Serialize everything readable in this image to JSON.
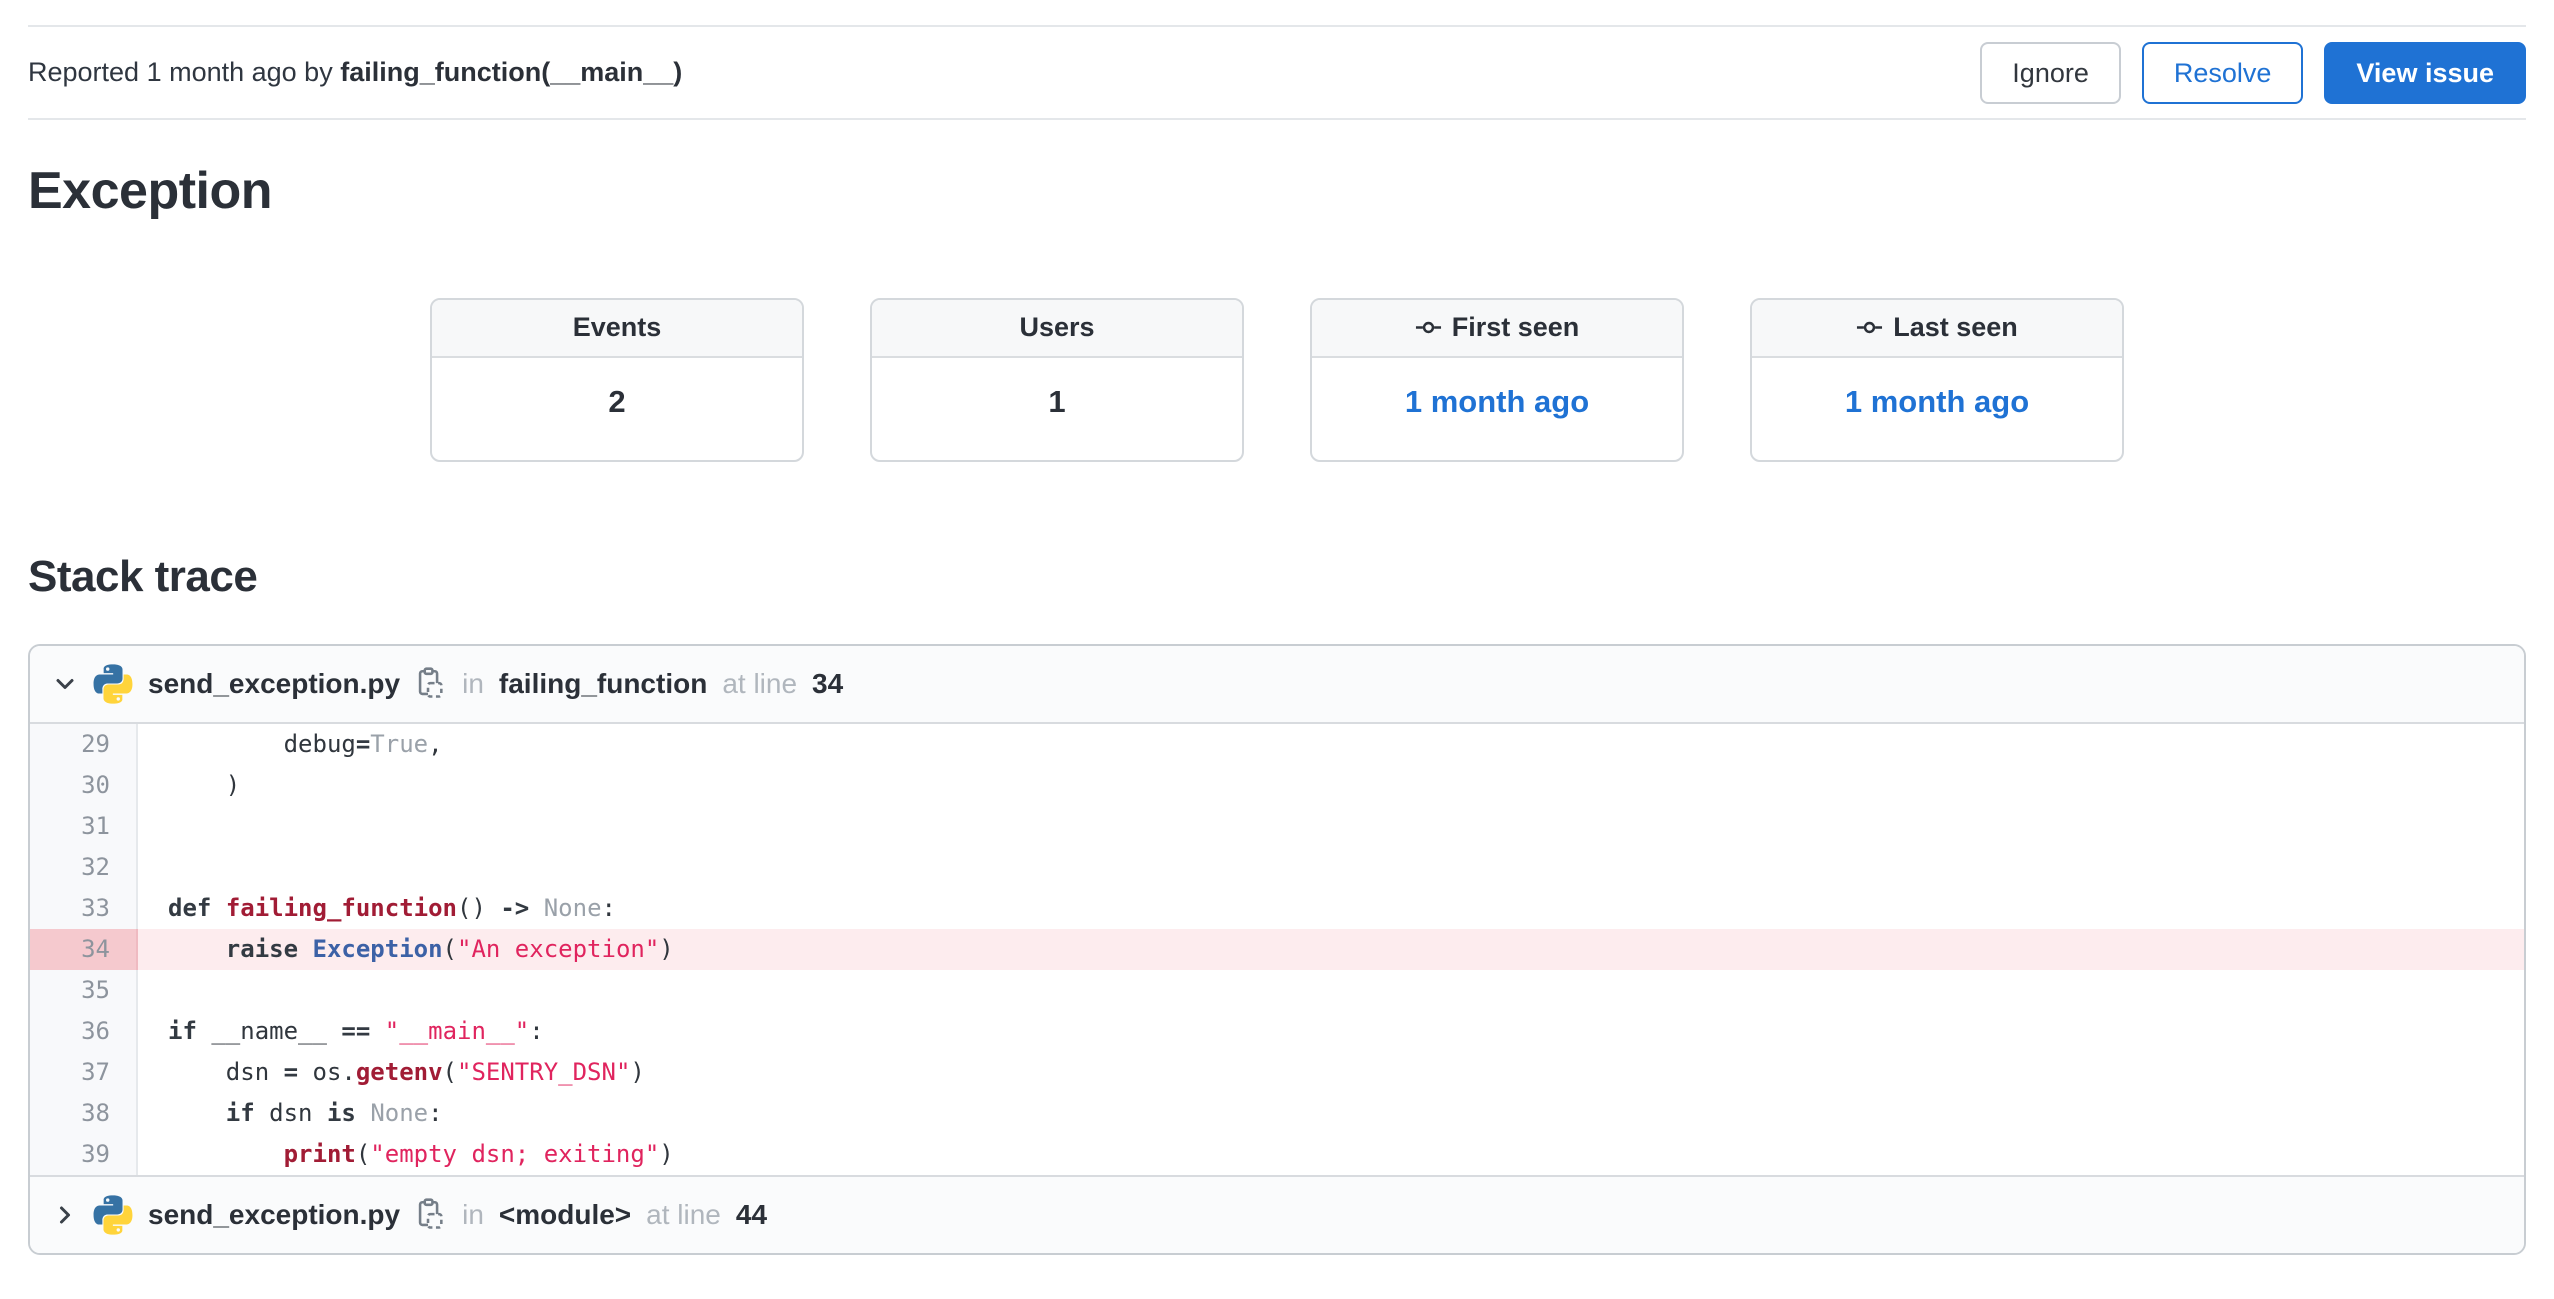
{
  "topbar": {
    "reported_prefix": "Reported 1 month ago by",
    "reporter": "failing_function(__main__)",
    "buttons": [
      {
        "label": "Ignore"
      },
      {
        "label": "Resolve"
      },
      {
        "label": "View issue"
      }
    ]
  },
  "exception": {
    "title": "Exception"
  },
  "stats": {
    "cards": [
      {
        "label": "Events",
        "value": "2"
      },
      {
        "label": "Users",
        "value": "1"
      },
      {
        "label": "First seen",
        "value": "1 month ago",
        "icon": "commit-icon",
        "value_is_link": true
      },
      {
        "label": "Last seen",
        "value": "1 month ago",
        "icon": "commit-icon",
        "value_is_link": true
      }
    ]
  },
  "stack_trace": {
    "title": "Stack trace",
    "frames": [
      {
        "file": "send_exception.py",
        "expanded": true,
        "in_label": "in",
        "function": "failing_function",
        "at_label": "at line",
        "line_number": "34",
        "language": "python",
        "code_lines": [
          {
            "no": "29",
            "highlight": false,
            "tokens": [
              [
                "p",
                "        debug"
              ],
              [
                "k",
                "="
              ],
              [
                "mut",
                "True"
              ],
              [
                "p",
                ","
              ]
            ]
          },
          {
            "no": "30",
            "highlight": false,
            "tokens": [
              [
                "p",
                "    )"
              ]
            ]
          },
          {
            "no": "31",
            "highlight": false,
            "tokens": []
          },
          {
            "no": "32",
            "highlight": false,
            "tokens": []
          },
          {
            "no": "33",
            "highlight": false,
            "tokens": [
              [
                "k",
                "def"
              ],
              [
                "p",
                " "
              ],
              [
                "fn",
                "failing_function"
              ],
              [
                "p",
                "() "
              ],
              [
                "k",
                "->"
              ],
              [
                "p",
                " "
              ],
              [
                "mut",
                "None"
              ],
              [
                "p",
                ":"
              ]
            ]
          },
          {
            "no": "34",
            "highlight": true,
            "tokens": [
              [
                "p",
                "    "
              ],
              [
                "k",
                "raise"
              ],
              [
                "p",
                " "
              ],
              [
                "cls",
                "Exception"
              ],
              [
                "p",
                "("
              ],
              [
                "str",
                "\"An exception\""
              ],
              [
                "p",
                ")"
              ]
            ]
          },
          {
            "no": "35",
            "highlight": false,
            "tokens": []
          },
          {
            "no": "36",
            "highlight": false,
            "tokens": [
              [
                "k",
                "if"
              ],
              [
                "p",
                " __name__ "
              ],
              [
                "k",
                "=="
              ],
              [
                "p",
                " "
              ],
              [
                "str",
                "\"__main__\""
              ],
              [
                "p",
                ":"
              ]
            ]
          },
          {
            "no": "37",
            "highlight": false,
            "tokens": [
              [
                "p",
                "    dsn "
              ],
              [
                "k",
                "="
              ],
              [
                "p",
                " os."
              ],
              [
                "fn",
                "getenv"
              ],
              [
                "p",
                "("
              ],
              [
                "str",
                "\"SENTRY_DSN\""
              ],
              [
                "p",
                ")"
              ]
            ]
          },
          {
            "no": "38",
            "highlight": false,
            "tokens": [
              [
                "p",
                "    "
              ],
              [
                "k",
                "if"
              ],
              [
                "p",
                " dsn "
              ],
              [
                "k",
                "is"
              ],
              [
                "p",
                " "
              ],
              [
                "mut",
                "None"
              ],
              [
                "p",
                ":"
              ]
            ]
          },
          {
            "no": "39",
            "highlight": false,
            "tokens": [
              [
                "p",
                "        "
              ],
              [
                "fn",
                "print"
              ],
              [
                "p",
                "("
              ],
              [
                "str",
                "\"empty dsn; exiting\""
              ],
              [
                "p",
                ")"
              ]
            ]
          }
        ]
      },
      {
        "file": "send_exception.py",
        "expanded": false,
        "in_label": "in",
        "function": "<module>",
        "at_label": "at line",
        "line_number": "44"
      }
    ]
  },
  "icons": {
    "frame_language": "python-icon",
    "copy_filename": "copy-icon",
    "frame_expanded": "chevron-down-icon",
    "frame_collapsed": "chevron-right-icon",
    "seen_cards": "commit-icon"
  },
  "colors": {
    "accent_blue": "#1f72d4",
    "link_blue": "#1f72d4",
    "string_red": "#e0245e",
    "function_red": "#a11c35",
    "builtin_blue": "#3c61a6",
    "muted_gray": "#9aa1a9",
    "highlight_row_pink": "#fdecee",
    "highlight_gutter_pink": "#f5c9ce",
    "card_header_bg": "#f7f8f9",
    "border_gray": "#c8cdd2"
  }
}
